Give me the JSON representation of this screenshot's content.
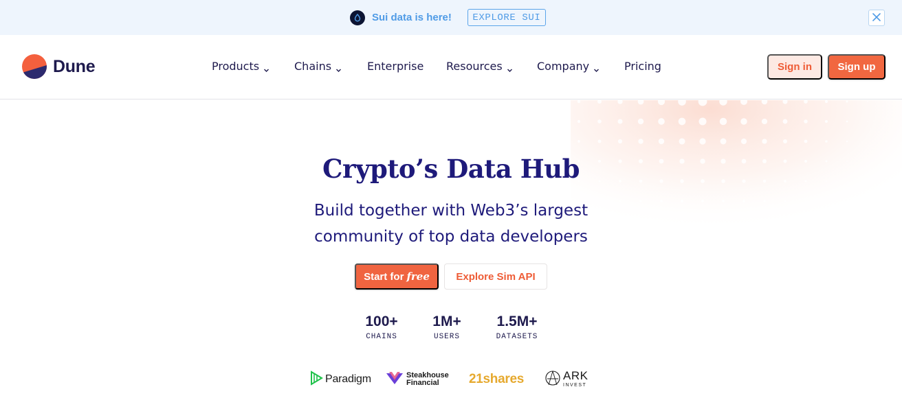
{
  "announcement": {
    "text": "Sui data is here!",
    "cta_label": "EXPLORE SUI",
    "icon": "sui-drop-icon",
    "close_icon": "close-icon"
  },
  "header": {
    "brand": "Dune",
    "nav": [
      {
        "label": "Products",
        "has_dropdown": true
      },
      {
        "label": "Chains",
        "has_dropdown": true
      },
      {
        "label": "Enterprise",
        "has_dropdown": false
      },
      {
        "label": "Resources",
        "has_dropdown": true
      },
      {
        "label": "Company",
        "has_dropdown": true
      },
      {
        "label": "Pricing",
        "has_dropdown": false
      }
    ],
    "sign_in_label": "Sign in",
    "sign_up_label": "Sign up"
  },
  "hero": {
    "title": "Crypto’s Data Hub",
    "subtitle_line1": "Build together with Web3’s largest",
    "subtitle_line2": "community of top data developers",
    "primary_cta_prefix": "Start for",
    "primary_cta_emphasis": "free",
    "secondary_cta": "Explore Sim API"
  },
  "stats": [
    {
      "value": "100+",
      "label": "CHAINS"
    },
    {
      "value": "1M+",
      "label": "USERS"
    },
    {
      "value": "1.5M+",
      "label": "DATASETS"
    }
  ],
  "partners": {
    "paradigm": "Paradigm",
    "steakhouse_line1": "Steakhouse",
    "steakhouse_line2": "Financial",
    "shares": "21shares",
    "ark_main": "ARK",
    "ark_sub": "INVEST"
  },
  "colors": {
    "brand_orange": "#f06440",
    "brand_navy": "#1e1a4d",
    "announce_blue": "#4f9be6",
    "announce_bg": "#eef5fd"
  }
}
